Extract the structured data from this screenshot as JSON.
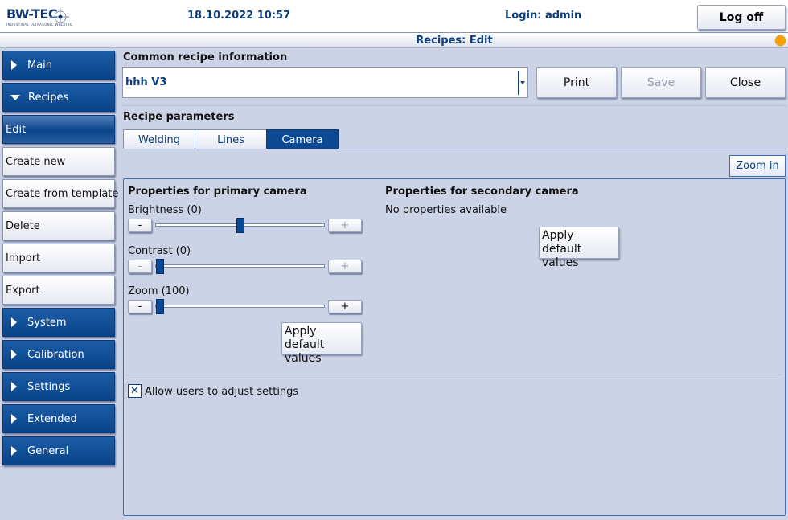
{
  "header": {
    "logo_text": "BW-TEC",
    "logo_tagline": "INDUSTRIAL ULTRASONIC WELDING",
    "datetime": "18.10.2022 10:57",
    "login": "Login: admin",
    "logoff_label": "Log off"
  },
  "title": "Recipes: Edit",
  "status_color": "#f5a000",
  "sidebar": {
    "items": [
      {
        "label": "Main",
        "type": "group",
        "expanded": false
      },
      {
        "label": "Recipes",
        "type": "group",
        "expanded": true
      },
      {
        "label": "Edit",
        "type": "sub",
        "active": true
      },
      {
        "label": "Create new",
        "type": "sub"
      },
      {
        "label": "Create from template",
        "type": "sub"
      },
      {
        "label": "Delete",
        "type": "sub"
      },
      {
        "label": "Import",
        "type": "sub"
      },
      {
        "label": "Export",
        "type": "sub"
      },
      {
        "label": "System",
        "type": "group",
        "expanded": false
      },
      {
        "label": "Calibration",
        "type": "group",
        "expanded": false
      },
      {
        "label": "Settings",
        "type": "group",
        "expanded": false
      },
      {
        "label": "Extended",
        "type": "group",
        "expanded": false
      },
      {
        "label": "General",
        "type": "group",
        "expanded": false
      }
    ]
  },
  "common": {
    "heading": "Common recipe information",
    "recipe_value": "hhh V3",
    "print_label": "Print",
    "save_label": "Save",
    "close_label": "Close"
  },
  "params": {
    "heading": "Recipe parameters",
    "tabs": [
      {
        "label": "Welding",
        "active": false
      },
      {
        "label": "Lines",
        "active": false
      },
      {
        "label": "Camera",
        "active": true
      }
    ],
    "zoom_in_label": "Zoom in"
  },
  "primary": {
    "heading": "Properties for primary camera",
    "brightness": {
      "label": "Brightness (0)",
      "value": 0,
      "min": -100,
      "max": 100
    },
    "contrast": {
      "label": "Contrast (0)",
      "value": 0,
      "min": 0,
      "max": 100
    },
    "zoom": {
      "label": "Zoom (100)",
      "value": 100,
      "min": 100,
      "max": 400
    },
    "minus": "-",
    "plus": "+",
    "apply_label": "Apply default values"
  },
  "secondary": {
    "heading": "Properties for secondary camera",
    "no_props": "No properties available",
    "apply_label": "Apply default values"
  },
  "allow_adjust": {
    "label": "Allow users to adjust settings",
    "checked": true,
    "mark": "✕"
  }
}
